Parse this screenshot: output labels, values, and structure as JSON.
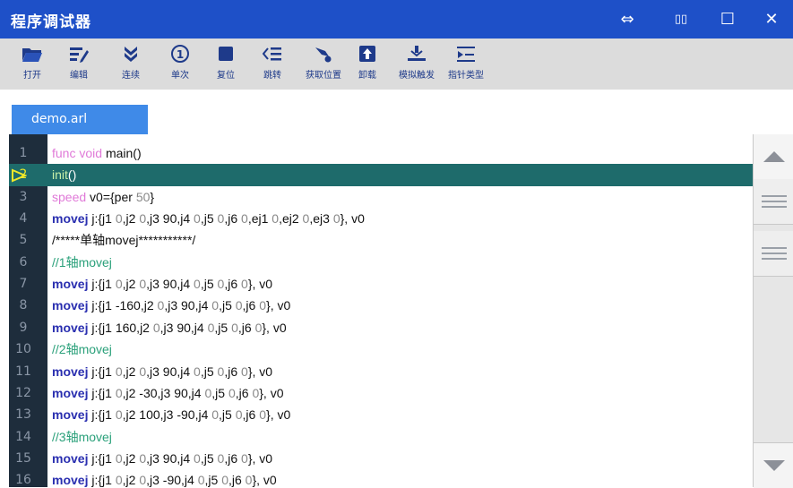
{
  "window": {
    "title": "程序调试器",
    "controls": [
      "⇔",
      "▯▯",
      "☐",
      "✕"
    ]
  },
  "toolbar": {
    "items": [
      {
        "label": "打开",
        "icon": "folder-open-icon"
      },
      {
        "label": "编辑",
        "icon": "edit-icon"
      },
      {
        "label": "连续",
        "icon": "double-chevron-down-icon"
      },
      {
        "label": "单次",
        "icon": "step-once-icon"
      },
      {
        "label": "复位",
        "icon": "stop-square-icon"
      },
      {
        "label": "跳转",
        "icon": "jump-list-icon"
      },
      {
        "label": "获取位置",
        "icon": "get-position-icon"
      },
      {
        "label": "卸载",
        "icon": "unload-icon"
      },
      {
        "label": "模拟触发",
        "icon": "simulate-trigger-icon"
      },
      {
        "label": "指针类型",
        "icon": "pointer-type-icon"
      }
    ]
  },
  "tab": {
    "label": "demo.arl"
  },
  "editor": {
    "current_line": 2,
    "lines": [
      {
        "n": "1",
        "seg": [
          [
            "kw",
            "func void "
          ],
          [
            "",
            "main()"
          ]
        ]
      },
      {
        "n": "2",
        "seg": [
          [
            "hlcall",
            "init"
          ],
          [
            "",
            "()"
          ]
        ]
      },
      {
        "n": "3",
        "seg": [
          [
            "kw",
            "speed "
          ],
          [
            "",
            "v0={per "
          ],
          [
            "num",
            "50"
          ],
          [
            "",
            "}"
          ]
        ]
      },
      {
        "n": "4",
        "seg": [
          [
            "kw2",
            "movej "
          ],
          [
            "",
            "j:{j1 "
          ],
          [
            "num",
            "0"
          ],
          [
            "",
            ",j2 "
          ],
          [
            "num",
            "0"
          ],
          [
            "",
            ",j3 90,j4 "
          ],
          [
            "num",
            "0"
          ],
          [
            "",
            ",j5 "
          ],
          [
            "num",
            "0"
          ],
          [
            "",
            ",j6 "
          ],
          [
            "num",
            "0"
          ],
          [
            "",
            ",ej1 "
          ],
          [
            "num",
            "0"
          ],
          [
            "",
            ",ej2 "
          ],
          [
            "num",
            "0"
          ],
          [
            "",
            ",ej3 "
          ],
          [
            "num",
            "0"
          ],
          [
            "",
            "}, v0"
          ]
        ]
      },
      {
        "n": "5",
        "seg": [
          [
            "",
            "/*****单轴movej***********/"
          ]
        ]
      },
      {
        "n": "6",
        "seg": [
          [
            "cm",
            "//1轴movej"
          ]
        ]
      },
      {
        "n": "7",
        "seg": [
          [
            "kw2",
            "movej "
          ],
          [
            "",
            "j:{j1 "
          ],
          [
            "num",
            "0"
          ],
          [
            "",
            ",j2 "
          ],
          [
            "num",
            "0"
          ],
          [
            "",
            ",j3 90,j4 "
          ],
          [
            "num",
            "0"
          ],
          [
            "",
            ",j5 "
          ],
          [
            "num",
            "0"
          ],
          [
            "",
            ",j6 "
          ],
          [
            "num",
            "0"
          ],
          [
            "",
            "}, v0"
          ]
        ]
      },
      {
        "n": "8",
        "seg": [
          [
            "kw2",
            "movej "
          ],
          [
            "",
            "j:{j1 -160,j2 "
          ],
          [
            "num",
            "0"
          ],
          [
            "",
            ",j3 90,j4 "
          ],
          [
            "num",
            "0"
          ],
          [
            "",
            ",j5 "
          ],
          [
            "num",
            "0"
          ],
          [
            "",
            ",j6 "
          ],
          [
            "num",
            "0"
          ],
          [
            "",
            "}, v0"
          ]
        ]
      },
      {
        "n": "9",
        "seg": [
          [
            "kw2",
            "movej "
          ],
          [
            "",
            "j:{j1 160,j2 "
          ],
          [
            "num",
            "0"
          ],
          [
            "",
            ",j3 90,j4 "
          ],
          [
            "num",
            "0"
          ],
          [
            "",
            ",j5 "
          ],
          [
            "num",
            "0"
          ],
          [
            "",
            ",j6 "
          ],
          [
            "num",
            "0"
          ],
          [
            "",
            "}, v0"
          ]
        ]
      },
      {
        "n": "10",
        "seg": [
          [
            "cm",
            "//2轴movej"
          ]
        ]
      },
      {
        "n": "11",
        "seg": [
          [
            "kw2",
            "movej "
          ],
          [
            "",
            "j:{j1 "
          ],
          [
            "num",
            "0"
          ],
          [
            "",
            ",j2 "
          ],
          [
            "num",
            "0"
          ],
          [
            "",
            ",j3 90,j4 "
          ],
          [
            "num",
            "0"
          ],
          [
            "",
            ",j5 "
          ],
          [
            "num",
            "0"
          ],
          [
            "",
            ",j6 "
          ],
          [
            "num",
            "0"
          ],
          [
            "",
            "}, v0"
          ]
        ]
      },
      {
        "n": "12",
        "seg": [
          [
            "kw2",
            "movej "
          ],
          [
            "",
            "j:{j1 "
          ],
          [
            "num",
            "0"
          ],
          [
            "",
            ",j2 -30,j3 90,j4 "
          ],
          [
            "num",
            "0"
          ],
          [
            "",
            ",j5 "
          ],
          [
            "num",
            "0"
          ],
          [
            "",
            ",j6 "
          ],
          [
            "num",
            "0"
          ],
          [
            "",
            "}, v0"
          ]
        ]
      },
      {
        "n": "13",
        "seg": [
          [
            "kw2",
            "movej "
          ],
          [
            "",
            "j:{j1 "
          ],
          [
            "num",
            "0"
          ],
          [
            "",
            ",j2 100,j3 -90,j4 "
          ],
          [
            "num",
            "0"
          ],
          [
            "",
            ",j5 "
          ],
          [
            "num",
            "0"
          ],
          [
            "",
            ",j6 "
          ],
          [
            "num",
            "0"
          ],
          [
            "",
            "}, v0"
          ]
        ]
      },
      {
        "n": "14",
        "seg": [
          [
            "cm",
            "//3轴movej"
          ]
        ]
      },
      {
        "n": "15",
        "seg": [
          [
            "kw2",
            "movej "
          ],
          [
            "",
            "j:{j1 "
          ],
          [
            "num",
            "0"
          ],
          [
            "",
            ",j2 "
          ],
          [
            "num",
            "0"
          ],
          [
            "",
            ",j3 90,j4 "
          ],
          [
            "num",
            "0"
          ],
          [
            "",
            ",j5 "
          ],
          [
            "num",
            "0"
          ],
          [
            "",
            ",j6 "
          ],
          [
            "num",
            "0"
          ],
          [
            "",
            "}, v0"
          ]
        ]
      },
      {
        "n": "16",
        "seg": [
          [
            "kw2",
            "movej "
          ],
          [
            "",
            "j:{j1 "
          ],
          [
            "num",
            "0"
          ],
          [
            "",
            ",j2 "
          ],
          [
            "num",
            "0"
          ],
          [
            "",
            ",j3 -90,j4 "
          ],
          [
            "num",
            "0"
          ],
          [
            "",
            ",j5 "
          ],
          [
            "num",
            "0"
          ],
          [
            "",
            ",j6 "
          ],
          [
            "num",
            "0"
          ],
          [
            "",
            "}, v0"
          ]
        ]
      }
    ]
  },
  "colors": {
    "titlebar": "#1e50c8",
    "tab": "#3f8ae8",
    "gutter": "#1e2d3c",
    "current_line": "#1e6b6b",
    "keyword_func": "#e07ad8",
    "keyword_move": "#2a2fb0",
    "comment": "#2aa07a"
  }
}
